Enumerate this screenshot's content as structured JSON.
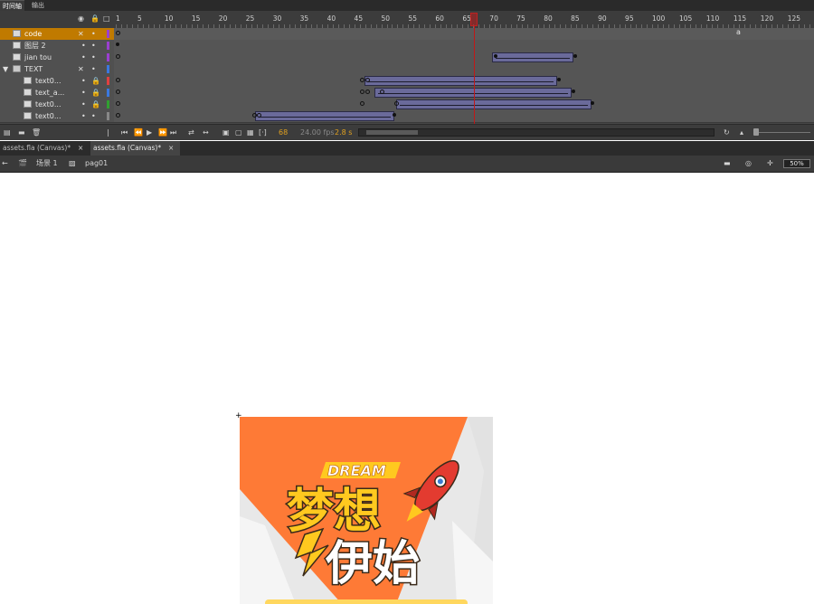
{
  "panel_tabs": [
    {
      "label": "时间轴",
      "active": true
    },
    {
      "label": "输出",
      "active": false
    }
  ],
  "timeline": {
    "header_icons": [
      "eye-icon",
      "lock-icon",
      "outline-icon"
    ],
    "ruler_numbers": [
      "1",
      "5",
      "10",
      "15",
      "20",
      "25",
      "30",
      "35",
      "40",
      "45",
      "50",
      "55",
      "60",
      "65",
      "70",
      "75",
      "80",
      "85",
      "90",
      "95",
      "100",
      "105",
      "110",
      "115",
      "120",
      "125"
    ],
    "layers": [
      {
        "name": "code",
        "icon": "layer-icon",
        "color": "#9a3fd0",
        "selected": true
      },
      {
        "name": "图层 2",
        "icon": "layer-icon",
        "color": "#9a3fd0"
      },
      {
        "name": "jian tou",
        "icon": "layer-icon",
        "color": "#9a3fd0"
      },
      {
        "name": "TEXT",
        "icon": "folder-icon",
        "color": "#3a78e0",
        "folder": true
      },
      {
        "name": "text0...",
        "icon": "layer-icon",
        "color": "#e04040",
        "locked": true
      },
      {
        "name": "text_a...",
        "icon": "layer-icon",
        "color": "#3a78e0",
        "locked": true
      },
      {
        "name": "text0...",
        "icon": "layer-icon",
        "color": "#30a030",
        "locked": true
      },
      {
        "name": "text0...",
        "icon": "layer-icon",
        "color": "#888888"
      }
    ],
    "controls": {
      "fps": "24.00 fps",
      "time": "2.8 s",
      "frame": "68"
    }
  },
  "document_tabs": [
    {
      "label": "assets.fla (Canvas)*",
      "active": false
    },
    {
      "label": "assets.fla (Canvas)*",
      "active": true
    }
  ],
  "edit_bar": {
    "scene_label": "场景 1",
    "symbol_label": "pag01",
    "zoom": "50%"
  },
  "canvas": {
    "badge_text": "DREAM",
    "title_line1": "梦想",
    "title_line2": "伊始",
    "colors": {
      "orange": "#fe7a36",
      "grey": "#e6e6e6",
      "yellow": "#ffc91f"
    }
  }
}
